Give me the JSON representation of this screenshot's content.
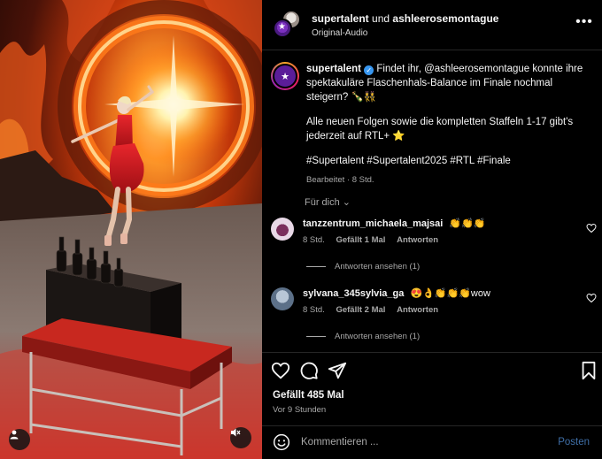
{
  "header": {
    "account": "supertalent",
    "joiner": "und",
    "collaborator": "ashleerosemontague",
    "audio": "Original-Audio",
    "more_glyph": "•••"
  },
  "caption": {
    "username": "supertalent",
    "line1": "Findet ihr, @ashleerosemontague konnte ihre spektakuläre Flaschenhals-Balance im Finale nochmal steigern? 🍾👯",
    "line2": "Alle neuen Folgen sowie die kompletten Staffeln 1-17 gibt's jederzeit auf RTL+ ⭐",
    "hashtags": "#Supertalent #Supertalent2025 #RTL #Finale",
    "edited": "Bearbeitet · 8 Std."
  },
  "sort_label": "Für dich ⌄",
  "comments": [
    {
      "username": "tanzzentrum_michaela_majsai",
      "text": "👏👏👏",
      "time": "8 Std.",
      "likes": "Gefällt 1 Mal",
      "reply": "Antworten",
      "view_replies": "Antworten ansehen (1)"
    },
    {
      "username": "sylvana_345sylvia_ga",
      "text": "😍👌👏👏👏wow",
      "time": "8 Std.",
      "likes": "Gefällt 2 Mal",
      "reply": "Antworten",
      "view_replies": "Antworten ansehen (1)"
    }
  ],
  "post": {
    "likes": "Gefällt 485 Mal",
    "time_ago": "Vor 9 Stunden"
  },
  "comment_box": {
    "placeholder": "Kommentieren ...",
    "post_label": "Posten"
  },
  "icons": {
    "like": "heart-icon",
    "comment": "comment-bubble-icon",
    "share": "paper-plane-icon",
    "save": "bookmark-icon",
    "emoji": "smiley-icon",
    "user_tag": "user-icon",
    "mute": "speaker-muted-icon"
  },
  "colors": {
    "accent_link": "#3f6fa8",
    "verified": "#3897f0",
    "background": "#000000"
  }
}
